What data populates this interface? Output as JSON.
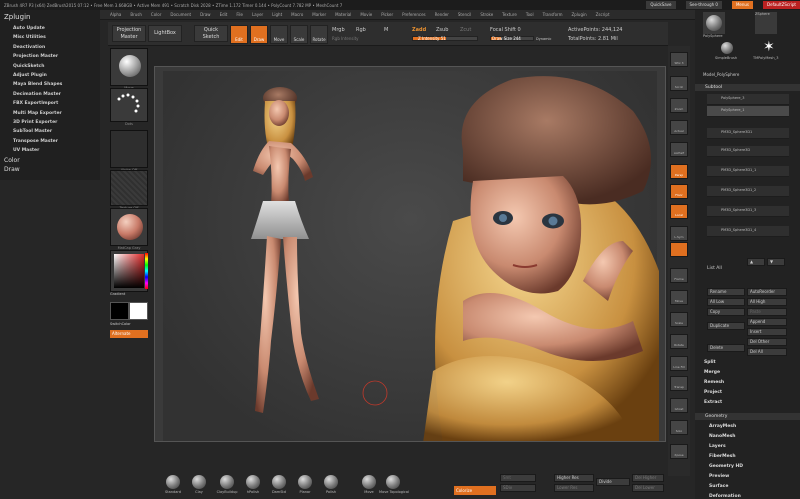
{
  "titlebar": {
    "title": "ZBrush 4R7 P3 (x64) ZedBrush2015 07:12 • Free Mem 3.668GB • Active Mem 491 • Scratch Disk 2028 • ZTime 1.172 Timer 0.144 • PolyCount 7.782 MP • MeshCount 7",
    "quicksave": "QuickSave",
    "seethrough": "See-through 0",
    "menus": "Menus",
    "defaultscript": "DefaultZScript"
  },
  "menubar": [
    "Alpha",
    "Brush",
    "Color",
    "Document",
    "Draw",
    "Edit",
    "File",
    "Layer",
    "Light",
    "Macro",
    "Marker",
    "Material",
    "Movie",
    "Picker",
    "Preferences",
    "Render",
    "Stencil",
    "Stroke",
    "Texture",
    "Tool",
    "Transform",
    "Zplugin",
    "Zscript"
  ],
  "toolbar": {
    "projection_master": "Projection Master",
    "lightbox": "LightBox",
    "quick_sketch": "Quick Sketch",
    "edit": "Edit",
    "draw": "Draw",
    "move": "Move",
    "scale": "Scale",
    "rotate": "Rotate",
    "mrgb": "Mrgb",
    "rgb": "Rgb",
    "m": "M",
    "rgb_intensity": "Rgb Intensity",
    "zadd": "Zadd",
    "zsub": "Zsub",
    "zcut": "Zcut",
    "z_intensity": "Z Intensity 51",
    "focal_shift": "Focal Shift 0",
    "draw_size": "Draw Size 244",
    "dynamic": "Dynamic",
    "active_points": "ActivePoints: 244,124",
    "total_points": "TotalPoints: 2.81 Mil"
  },
  "plugin": {
    "header": "Zplugin",
    "items": [
      "Auto Update",
      "Misc Utilities",
      "Deactivation",
      "Projection Master",
      "QuickSketch",
      "Adjust Plugin",
      "Maya Blend Shapes",
      "Decimation Master",
      "FBX ExportImport",
      "Multi Map Exporter",
      "3D Print Exporter",
      "SubTool Master",
      "Transpose Master",
      "UV Master"
    ],
    "groups": [
      "Color",
      "Draw"
    ]
  },
  "shelf": {
    "brush_label": "Move",
    "stroke_label": "Dots",
    "alpha_label": "Alpha Off",
    "texture_label": "Texture Off",
    "material_label": "MatCap Gray",
    "gradient": "Gradient",
    "switch_color": "SwitchColor",
    "alternate": "Alternate"
  },
  "rightcol": [
    "SPix 3",
    "Scroll",
    "Zoom",
    "Actual",
    "AAHalf",
    "Persp",
    "Floor",
    "Local",
    "L.Sym",
    "Frame",
    "Move",
    "Scale",
    "Rotate",
    "Line Fill",
    "Transp",
    "Ghost",
    "Solo",
    "Xpose"
  ],
  "tool": {
    "zsphere": "ZSphere",
    "polysphere": "PolySphere",
    "simplebrush": "SimpleBrush",
    "tmpolymesh": "TMPolyMesh_3",
    "current": "Model_PolySphere",
    "subtool_header": "Subtool",
    "subtools": [
      "PolySphere_3",
      "PolySphere_1",
      "PM3D_Sphere3D1",
      "PM3D_Sphere3D",
      "PM3D_Sphere3D1_1",
      "PM3D_Sphere3D1_2",
      "PM3D_Sphere3D1_3",
      "PM3D_Sphere3D1_4"
    ],
    "list_all": "List All",
    "rename": "Rename",
    "autoreorder": "AutoReorder",
    "all_low": "All Low",
    "all_high": "All High",
    "copy": "Copy",
    "paste": "Paste",
    "duplicate": "Duplicate",
    "append": "Append",
    "insert": "Insert",
    "delete": "Delete",
    "del_other": "Del Other",
    "del_all": "Del All",
    "sections": [
      "Split",
      "Merge",
      "Remesh",
      "Project",
      "Extract"
    ],
    "sections2": [
      "Geometry",
      "ArrayMesh",
      "NanoMesh",
      "Layers",
      "FiberMesh",
      "Geometry HD",
      "Preview",
      "Surface",
      "Deformation"
    ]
  },
  "bottom": {
    "brushes": [
      "Standard",
      "Clay",
      "ClayBuildup",
      "hPolish",
      "DamStd",
      "Planar",
      "Polish",
      "Move",
      "Move Topological"
    ],
    "colorize": "Colorize",
    "higher_res": "Higher Res",
    "lower_res": "Lower Res",
    "sdiv": "SDiv",
    "divide": "Divide",
    "del_higher": "Del Higher",
    "del_lower": "Del Lower",
    "smt": "Smt"
  }
}
